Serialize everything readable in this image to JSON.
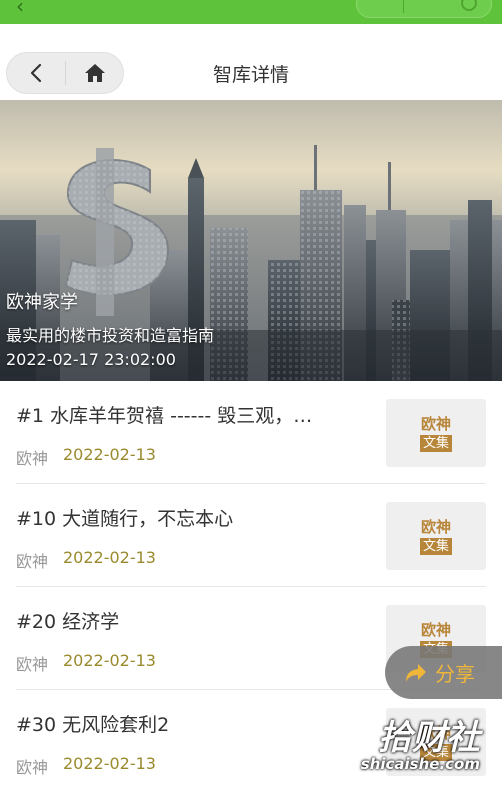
{
  "nav": {
    "title": "智库详情"
  },
  "hero": {
    "line1": "欧神家学",
    "line2": "最实用的楼市投资和造富指南",
    "line3": "2022-02-17 23:02:00"
  },
  "articles": [
    {
      "title": "#1 水库羊年贺禧 ------ 毁三观，…",
      "author": "欧神",
      "date": "2022-02-13",
      "thumb_top": "欧神",
      "thumb_bottom": "文集"
    },
    {
      "title": "#10 大道随行，不忘本心",
      "author": "欧神",
      "date": "2022-02-13",
      "thumb_top": "欧神",
      "thumb_bottom": "文集"
    },
    {
      "title": "#20 经济学",
      "author": "欧神",
      "date": "2022-02-13",
      "thumb_top": "欧神",
      "thumb_bottom": "文集"
    },
    {
      "title": "#30 无风险套利2",
      "author": "欧神",
      "date": "2022-02-13",
      "thumb_top": "欧神",
      "thumb_bottom": "文集"
    }
  ],
  "share": {
    "label": "分享"
  },
  "watermark": {
    "line1": "拾财社",
    "line2": "shicaishe.com"
  },
  "colors": {
    "topbar": "#5ec33b",
    "date": "#9a8a2e",
    "thumb_accent": "#b8863a",
    "share_text": "#f0b63a"
  }
}
